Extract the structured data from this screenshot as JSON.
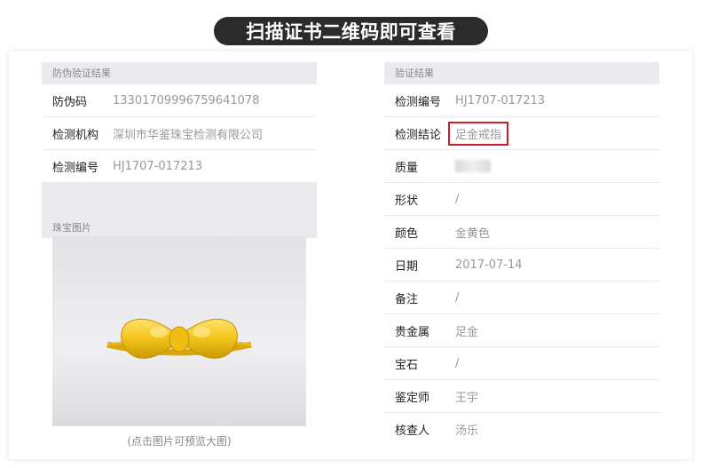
{
  "banner": {
    "title": "扫描证书二维码即可查看"
  },
  "left": {
    "section_title": "防伪验证结果",
    "rows": [
      {
        "label": "防伪码",
        "value": "13301709996759641078"
      },
      {
        "label": "检测机构",
        "value": "深圳市华鉴珠宝检测有限公司"
      },
      {
        "label": "检测编号",
        "value": "HJ1707-017213"
      }
    ],
    "photo_section_title": "珠宝图片",
    "photo_caption": "(点击图片可预览大图)",
    "photo_icon": "gold-bow-ring-photo"
  },
  "right": {
    "section_title": "验证结果",
    "rows": [
      {
        "label": "检测编号",
        "value": "HJ1707-017213"
      },
      {
        "label": "检测结论",
        "value": "足金戒指"
      },
      {
        "label": "质量",
        "value": ""
      },
      {
        "label": "形状",
        "value": "/"
      },
      {
        "label": "颜色",
        "value": "金黄色"
      },
      {
        "label": "日期",
        "value": "2017-07-14"
      },
      {
        "label": "备注",
        "value": "/"
      },
      {
        "label": "贵金属",
        "value": "足金"
      },
      {
        "label": "宝石",
        "value": "/"
      },
      {
        "label": "鉴定师",
        "value": "王宇"
      },
      {
        "label": "核查人",
        "value": "汤乐"
      }
    ]
  },
  "colors": {
    "highlight": "#d0182a",
    "banner_bg": "#2b2b2b",
    "gold": "#f2c318"
  }
}
